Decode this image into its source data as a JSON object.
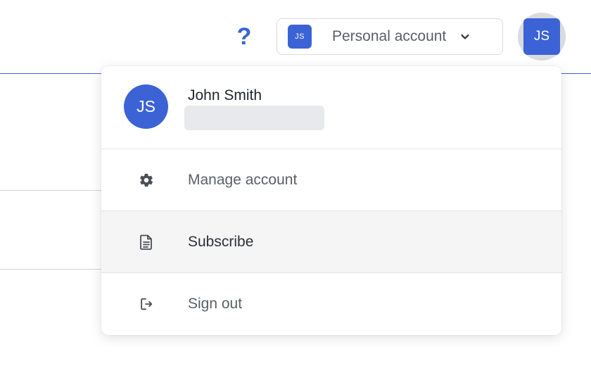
{
  "header": {
    "help_glyph": "?",
    "account_switcher": {
      "badge": "JS",
      "label": "Personal account",
      "chevron_icon": "chevron-down-icon"
    },
    "avatar_initials": "JS"
  },
  "menu": {
    "user": {
      "initials": "JS",
      "name": "John Smith"
    },
    "items": [
      {
        "label": "Manage account",
        "icon": "gear-icon"
      },
      {
        "label": "Subscribe",
        "icon": "document-icon",
        "hovered": true
      },
      {
        "label": "Sign out",
        "icon": "sign-out-icon"
      }
    ]
  },
  "colors": {
    "accent": "#3b63d6",
    "muted_text": "#5a5f66",
    "hover_bg": "#f5f5f6"
  }
}
